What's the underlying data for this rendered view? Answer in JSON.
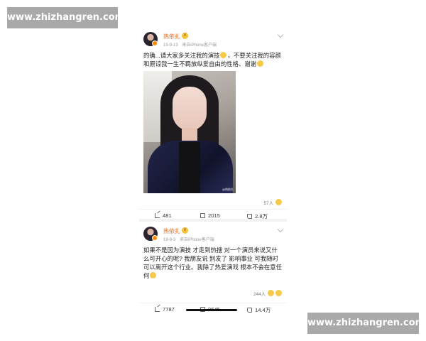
{
  "watermarks": {
    "top": "www.zhizhangren.com",
    "bottom": "www.zhizhangren.com"
  },
  "posts": [
    {
      "username": "热依扎",
      "date": "19-9-13",
      "source": "来自iPhone客户端",
      "content": "的确...请大家多关注我的演技",
      "content_cont": "，不要关注我的容颜和原谅我一生不羁放纵爱自由的性格、谢谢",
      "photo_caption": "@热依扎",
      "likes_count": "57人",
      "reposts": "481",
      "comments": "2015",
      "likes": "2.8万"
    },
    {
      "username": "热依扎",
      "date": "19-8-3",
      "source": "来自iPhone客户端",
      "content": "如果不是因为演技 才走到热搜 对一个演员来说又什么可开心的呢? 我朋友说 别发了 影响事业 可我随时可以离开这个行业。我除了热爱演戏 根本不会在意任何",
      "likes_count": "244人",
      "reposts": "7787",
      "comments": "9645",
      "likes": "14.4万"
    }
  ],
  "icons": {
    "avatar": "avatar",
    "vip": "vip-icon",
    "more": "chevron-down-icon",
    "share": "share-icon",
    "comment": "comment-icon",
    "like": "like-icon"
  },
  "colors": {
    "username": "#e86a19",
    "watermark_bg": "#a9a9a9"
  }
}
